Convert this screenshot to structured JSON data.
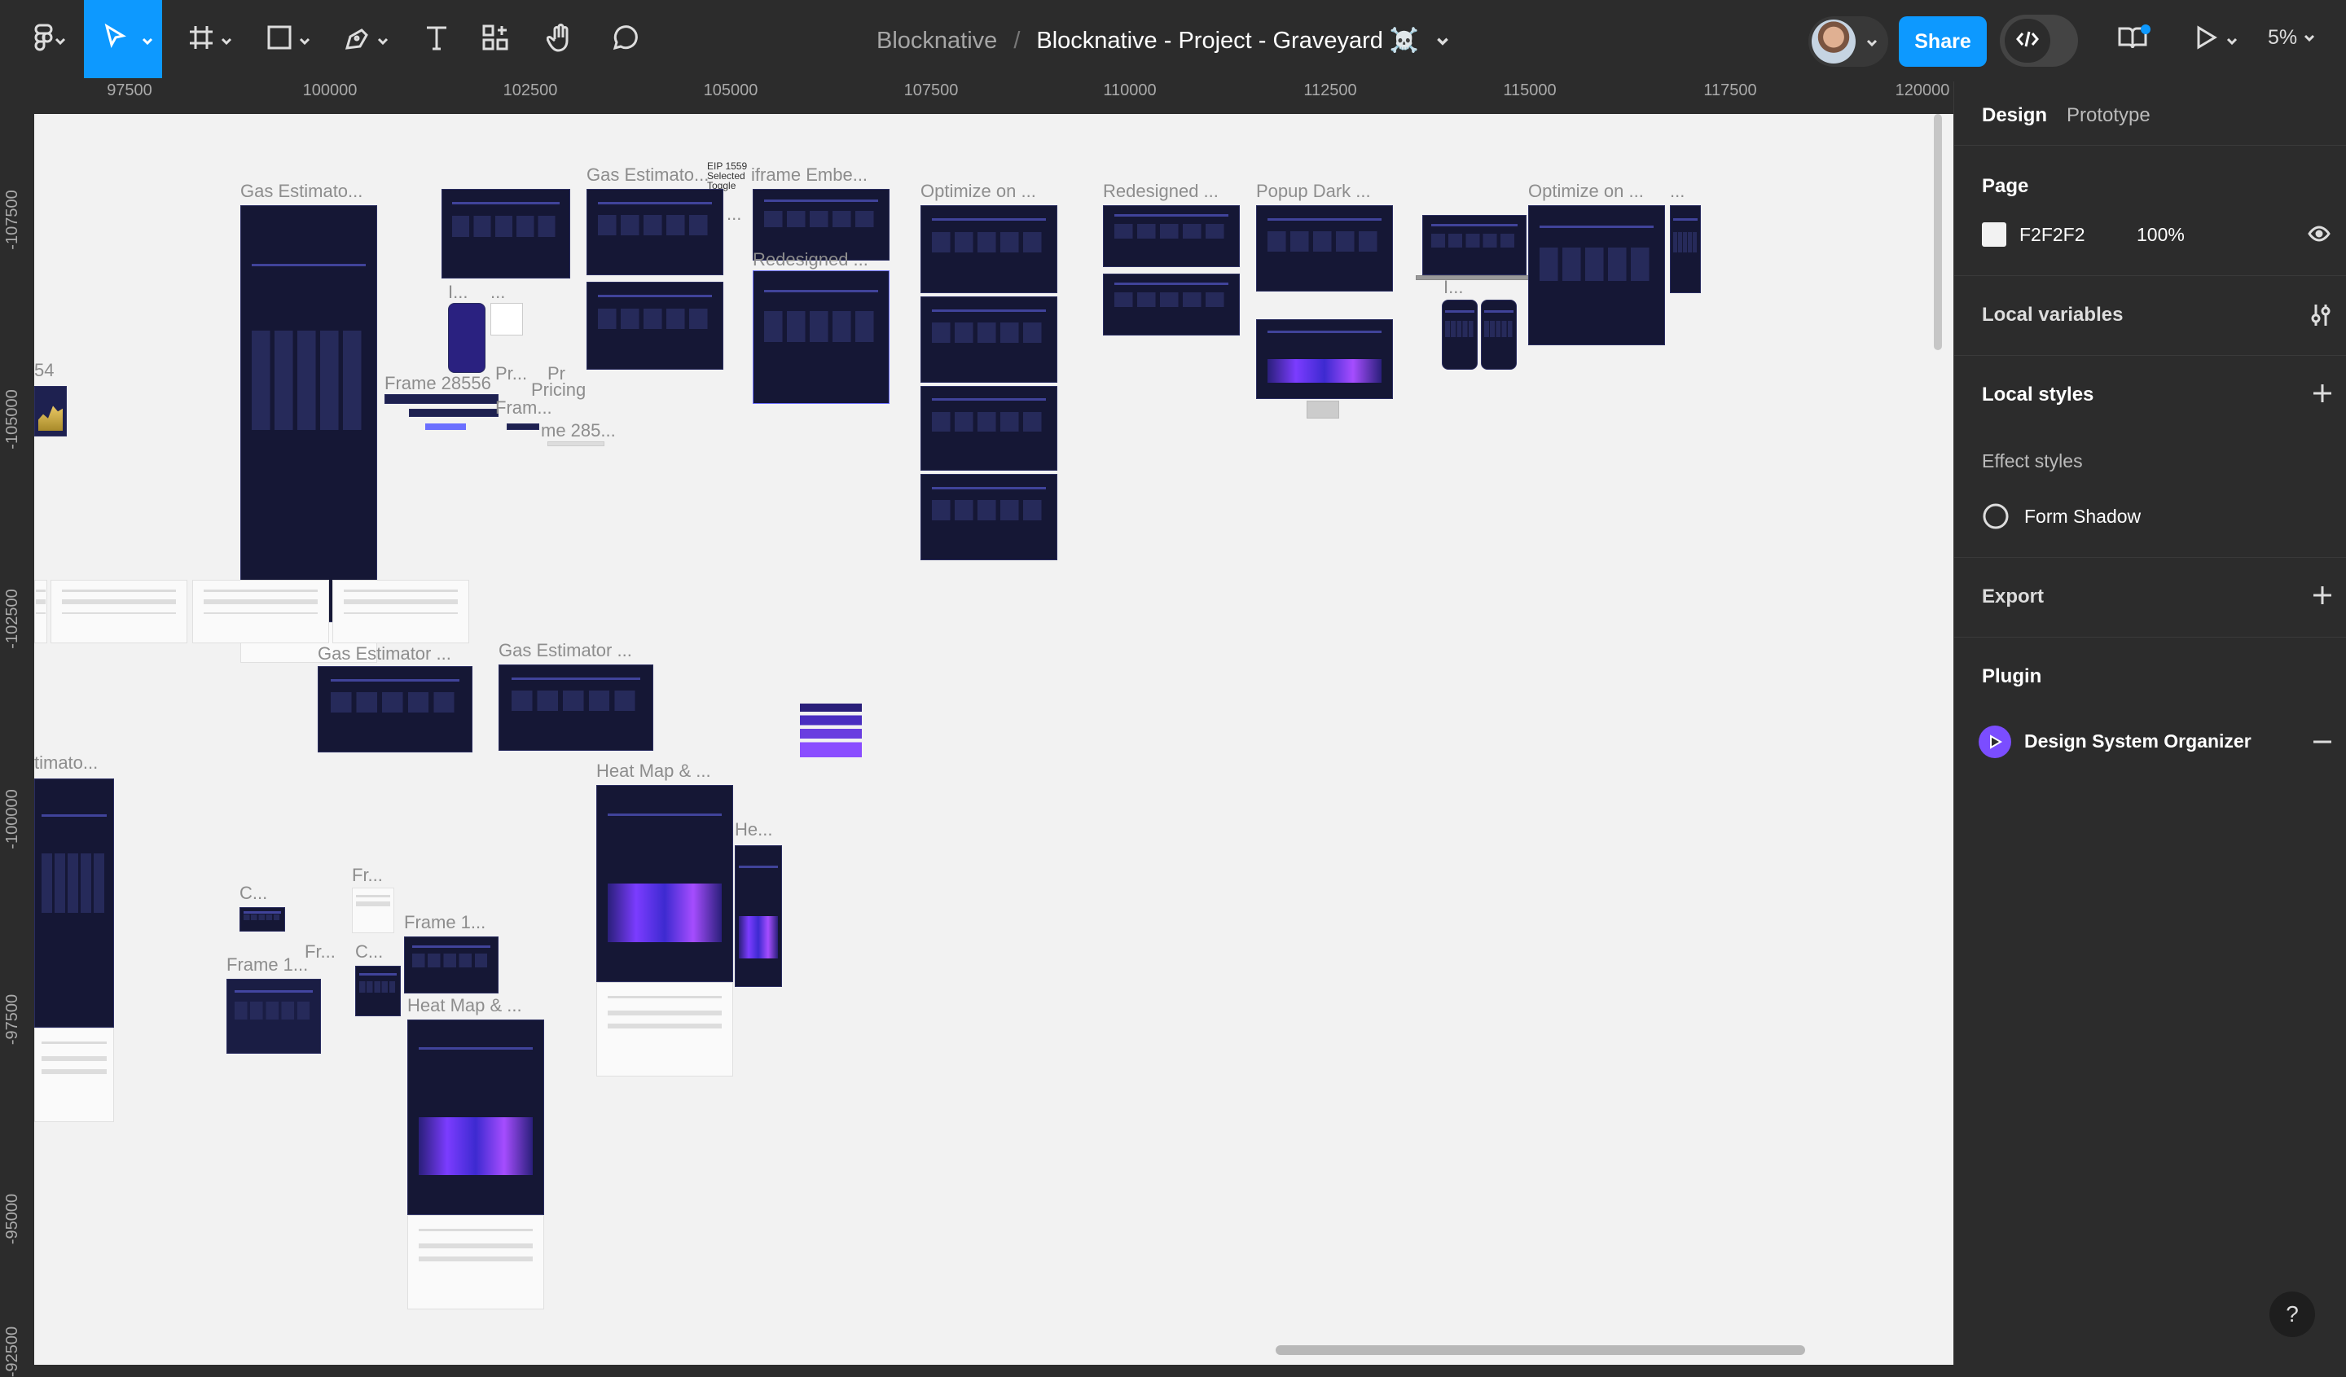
{
  "header": {
    "team": "Blocknative",
    "separator": "/",
    "file_name": "Blocknative - Project - Graveyard ☠️",
    "share_label": "Share",
    "zoom": "5%"
  },
  "ruler": {
    "top": [
      "97500",
      "100000",
      "102500",
      "105000",
      "107500",
      "110000",
      "112500",
      "115000",
      "117500",
      "120000"
    ],
    "left": [
      "-107500",
      "-105000",
      "-102500",
      "-100000",
      "-97500",
      "-95000",
      "-92500"
    ]
  },
  "canvas": {
    "labels": {
      "gas1": "Gas Estimato...",
      "gas2": "Gas Estimato...",
      "eip": "EIP 1559 Selected Toggle",
      "iframe": "iframe Embe...",
      "redesigned_a": "Redesigned ...",
      "optimize1": "Optimize on ...",
      "redesigned_b": "Redesigned ...",
      "popup": "Popup Dark ...",
      "optimize2": "Optimize on ...",
      "frame28556": "Frame 28556",
      "pr1": "Pr...",
      "pr2": "Pr",
      "pricing": "Pricing",
      "fram": "Fram...",
      "me285": "me 285...",
      "n54": "54",
      "gas3": "Gas Estimator ...",
      "gas4": "Gas Estimator ...",
      "timato": "timato...",
      "heatmap1": "Heat Map & ...",
      "he": "He...",
      "c1": "C...",
      "fr1": "Fr...",
      "frame1a": "Frame 1...",
      "frame1b": "Frame 1...",
      "fr2": "Fr...",
      "c2": "C...",
      "heatmap2": "Heat Map & ...",
      "dots1": "...",
      "dots2": "...",
      "dots3": "...",
      "i1": "I...",
      "i2": "I..."
    }
  },
  "panel": {
    "tabs": {
      "design": "Design",
      "prototype": "Prototype"
    },
    "page": {
      "title": "Page",
      "color": "F2F2F2",
      "opacity": "100%"
    },
    "local_variables": "Local variables",
    "local_styles": {
      "title": "Local styles",
      "effect_styles": "Effect styles",
      "style_name": "Form Shadow"
    },
    "export": "Export",
    "plugin": {
      "title": "Plugin",
      "name": "Design System Organizer"
    },
    "help": "?"
  },
  "colors": {
    "accent": "#0d99ff",
    "canvas": "#f2f2f2",
    "panel": "#2c2c2c",
    "frame_dark": "#151735",
    "plugin_purple": "#7b4dff"
  }
}
